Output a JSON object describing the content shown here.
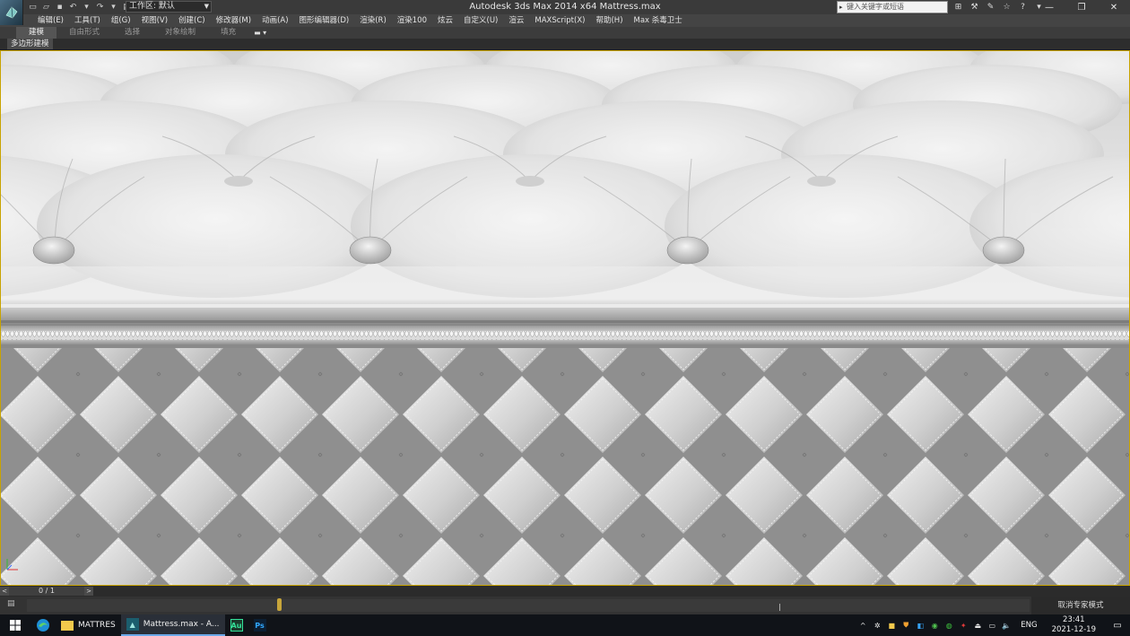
{
  "window": {
    "title": "Autodesk 3ds Max  2014 x64      Mattress.max",
    "workspace_label": "工作区: 默认",
    "search_placeholder": "键入关键字或短语",
    "controls": [
      "minimize-icon",
      "restore-icon",
      "close-icon"
    ]
  },
  "menu": {
    "items": [
      "编辑(E)",
      "工具(T)",
      "组(G)",
      "视图(V)",
      "创建(C)",
      "修改器(M)",
      "动画(A)",
      "图形编辑器(D)",
      "渲染(R)",
      "渲染100",
      "炫云",
      "自定义(U)",
      "渲云",
      "MAXScript(X)",
      "帮助(H)",
      "Max 杀毒卫士"
    ]
  },
  "ribbon": {
    "tabs": [
      "建模",
      "自由形式",
      "选择",
      "对象绘制",
      "填充"
    ],
    "active_tab": "建模",
    "subtab": "多边形建模"
  },
  "timeline": {
    "counter": "0 / 1",
    "prev_label": "<",
    "next_label": ">",
    "expert_mode_label": "取消专家模式"
  },
  "taskbar": {
    "items": [
      {
        "label": "MATTRES",
        "icon": "folder-icon"
      },
      {
        "label": "Mattress.max - A...",
        "icon": "3dsmax-icon"
      },
      {
        "label": "",
        "icon": "audition-icon",
        "text": "Au"
      },
      {
        "label": "",
        "icon": "photoshop-icon",
        "text": "Ps"
      }
    ],
    "language": "ENG",
    "time": "23:41",
    "date": "2021-12-19"
  },
  "colors": {
    "accent": "#6aa8e8",
    "viewport_border": "#c8a300",
    "keyframe": "#c7a53a"
  }
}
